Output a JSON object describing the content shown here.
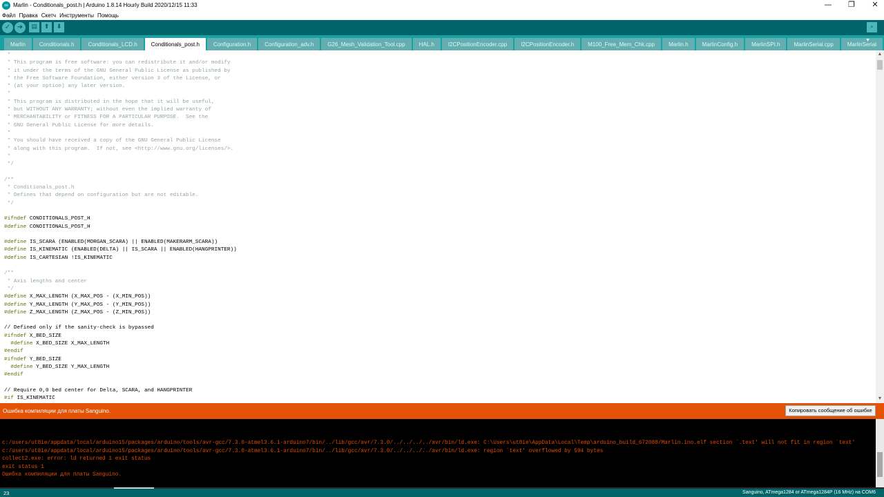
{
  "window": {
    "title": "Marlin - Conditionals_post.h | Arduino 1.8.14 Hourly Build 2020/12/15 11:33",
    "minimize": "—",
    "maximize": "❐",
    "close": "✕"
  },
  "menu": [
    "Файл",
    "Правка",
    "Скетч",
    "Инструменты",
    "Помощь"
  ],
  "toolbar": {
    "verify_icon": "check-icon",
    "upload_icon": "arrow-right-icon",
    "new_icon": "new-file-icon",
    "open_icon": "arrow-up-icon",
    "save_icon": "arrow-down-icon",
    "serial_icon": "magnifier-icon"
  },
  "tabs": [
    {
      "label": "Marlin",
      "active": false
    },
    {
      "label": "Conditionals.h",
      "active": false
    },
    {
      "label": "Conditionals_LCD.h",
      "active": false
    },
    {
      "label": "Conditionals_post.h",
      "active": true
    },
    {
      "label": "Configuration.h",
      "active": false
    },
    {
      "label": "Configuration_adv.h",
      "active": false
    },
    {
      "label": "G26_Mesh_Validation_Tool.cpp",
      "active": false
    },
    {
      "label": "HAL.h",
      "active": false
    },
    {
      "label": "I2CPositionEncoder.cpp",
      "active": false
    },
    {
      "label": "I2CPositionEncoder.h",
      "active": false
    },
    {
      "label": "M100_Free_Mem_Chk.cpp",
      "active": false
    },
    {
      "label": "Marlin.h",
      "active": false
    },
    {
      "label": "MarlinConfig.h",
      "active": false
    },
    {
      "label": "MarlinSPI.h",
      "active": false
    },
    {
      "label": "MarlinSerial.cpp",
      "active": false
    },
    {
      "label": "MarlinSerial",
      "active": false
    }
  ],
  "code_lines": [
    {
      "t": " *",
      "k": "comment"
    },
    {
      "t": " * This program is free software: you can redistribute it and/or modify",
      "k": "comment"
    },
    {
      "t": " * it under the terms of the GNU General Public License as published by",
      "k": "comment"
    },
    {
      "t": " * the Free Software Foundation, either version 3 of the License, or",
      "k": "comment"
    },
    {
      "t": " * (at your option) any later version.",
      "k": "comment"
    },
    {
      "t": " *",
      "k": "comment"
    },
    {
      "t": " * This program is distributed in the hope that it will be useful,",
      "k": "comment"
    },
    {
      "t": " * but WITHOUT ANY WARRANTY; without even the implied warranty of",
      "k": "comment"
    },
    {
      "t": " * MERCHANTABILITY or FITNESS FOR A PARTICULAR PURPOSE.  See the",
      "k": "comment"
    },
    {
      "t": " * GNU General Public License for more details.",
      "k": "comment"
    },
    {
      "t": " *",
      "k": "comment"
    },
    {
      "t": " * You should have received a copy of the GNU General Public License",
      "k": "comment"
    },
    {
      "t": " * along with this program.  If not, see <http://www.gnu.org/licenses/>.",
      "k": "comment"
    },
    {
      "t": " *",
      "k": "comment"
    },
    {
      "t": " */",
      "k": "comment"
    },
    {
      "t": "",
      "k": "plain"
    },
    {
      "t": "/**",
      "k": "comment"
    },
    {
      "t": " * Conditionals_post.h",
      "k": "comment"
    },
    {
      "t": " * Defines that depend on configuration but are not editable.",
      "k": "comment"
    },
    {
      "t": " */",
      "k": "comment"
    },
    {
      "t": "",
      "k": "plain"
    },
    {
      "t": "#ifndef",
      "r": " CONDITIONALS_POST_H",
      "k": "directive"
    },
    {
      "t": "#define",
      "r": " CONDITIONALS_POST_H",
      "k": "directive"
    },
    {
      "t": "",
      "k": "plain"
    },
    {
      "t": "#define",
      "r": " IS_SCARA (ENABLED(MORGAN_SCARA) || ENABLED(MAKERARM_SCARA))",
      "k": "directive"
    },
    {
      "t": "#define",
      "r": " IS_KINEMATIC (ENABLED(DELTA) || IS_SCARA || ENABLED(HANGPRINTER))",
      "k": "directive"
    },
    {
      "t": "#define",
      "r": " IS_CARTESIAN !IS_KINEMATIC",
      "k": "directive"
    },
    {
      "t": "",
      "k": "plain"
    },
    {
      "t": "/**",
      "k": "comment"
    },
    {
      "t": " * Axis lengths and center",
      "k": "comment"
    },
    {
      "t": " */",
      "k": "comment"
    },
    {
      "t": "#define",
      "r": " X_MAX_LENGTH (X_MAX_POS - (X_MIN_POS))",
      "k": "directive"
    },
    {
      "t": "#define",
      "r": " Y_MAX_LENGTH (Y_MAX_POS - (Y_MIN_POS))",
      "k": "directive"
    },
    {
      "t": "#define",
      "r": " Z_MAX_LENGTH (Z_MAX_POS - (Z_MIN_POS))",
      "k": "directive"
    },
    {
      "t": "",
      "k": "plain"
    },
    {
      "t": "// Defined only if the sanity-check is bypassed",
      "k": "plain"
    },
    {
      "t": "#ifndef",
      "r": " X_BED_SIZE",
      "k": "directive"
    },
    {
      "t": "  #define",
      "r": " X_BED_SIZE X_MAX_LENGTH",
      "k": "directive"
    },
    {
      "t": "#endif",
      "r": "",
      "k": "directive"
    },
    {
      "t": "#ifndef",
      "r": " Y_BED_SIZE",
      "k": "directive"
    },
    {
      "t": "  #define",
      "r": " Y_BED_SIZE Y_MAX_LENGTH",
      "k": "directive"
    },
    {
      "t": "#endif",
      "r": "",
      "k": "directive"
    },
    {
      "t": "",
      "k": "plain"
    },
    {
      "t": "// Require 0,0 bed center for Delta, SCARA, and HANGPRINTER",
      "k": "plain"
    },
    {
      "t": "#if",
      "r": " IS_KINEMATIC",
      "k": "directive"
    }
  ],
  "status": {
    "message": "Ошибка компиляции для платы Sanguino.",
    "copy_button": "Копировать сообщение об ошибке"
  },
  "console_lines": [
    "c:/users/ut8ie/appdata/local/arduino15/packages/arduino/tools/avr-gcc/7.3.0-atmel3.6.1-arduino7/bin/../lib/gcc/avr/7.3.0/../../../../avr/bin/ld.exe: C:\\Users\\ut8ie\\AppData\\Local\\Temp\\arduino_build_672088/Marlin.ino.elf section `.text' will not fit in region `text'",
    "c:/users/ut8ie/appdata/local/arduino15/packages/arduino/tools/avr-gcc/7.3.0-atmel3.6.1-arduino7/bin/../lib/gcc/avr/7.3.0/../../../../avr/bin/ld.exe: region `text' overflowed by 594 bytes",
    "collect2.exe: error: ld returned 1 exit status",
    "exit status 1",
    "Ошибка компиляции для платы Sanguino."
  ],
  "bottom": {
    "line_number": "23",
    "board": "Sanguino, ATmega1284 or ATmega1284P (16 MHz) на COM6"
  },
  "colors": {
    "toolbar": "#006468",
    "tabbar": "#17a1a5",
    "status_error": "#e35205",
    "console_text": "#e34c00"
  }
}
